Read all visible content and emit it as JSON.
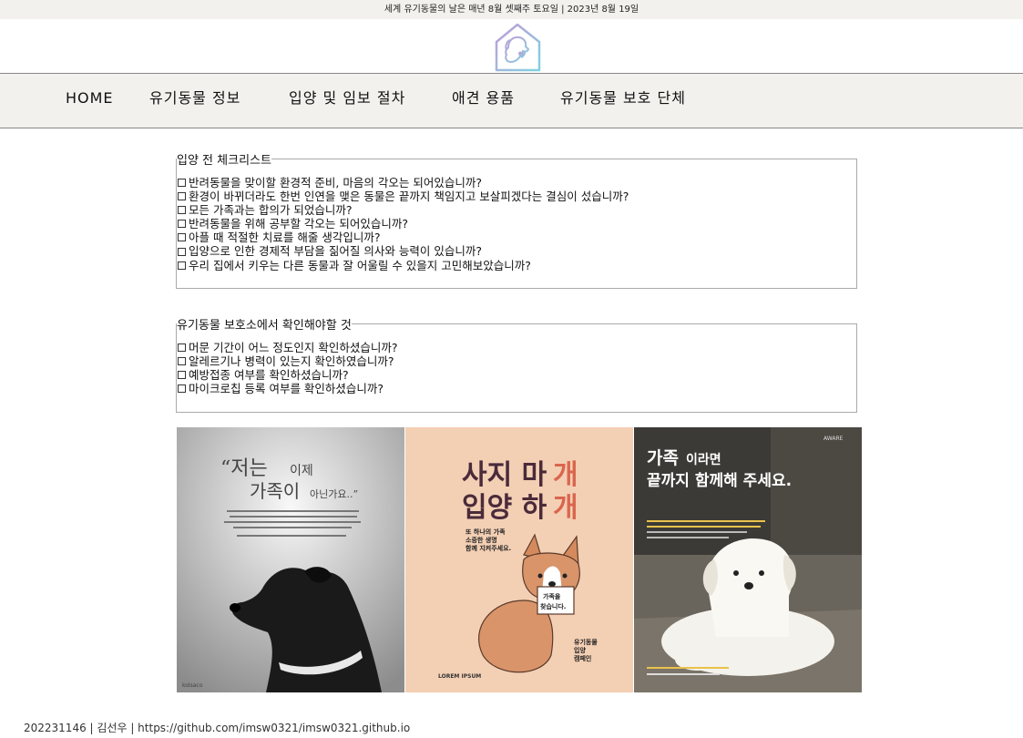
{
  "topbar": {
    "text": "세계 유기동물의 날은 매년 8월 셋째주 토요일 | 2023년 8월 19일"
  },
  "logo": {
    "icon": "house-dog-heart-logo",
    "color_start": "#c49ad8",
    "color_end": "#7fd3e0"
  },
  "nav": {
    "items": [
      {
        "label": "HOME"
      },
      {
        "label": "유기동물 정보"
      },
      {
        "label": "입양 및 임보 절차"
      },
      {
        "label": "애견 용품"
      },
      {
        "label": "유기동물 보호 단체"
      }
    ]
  },
  "checklist1": {
    "legend": "입양 전 체크리스트",
    "items": [
      "반려동물을 맞이할 환경적 준비, 마음의 각오는 되어있습니까?",
      "환경이 바뀌더라도 한번 인연을 맺은 동물은 끝까지 책임지고 보살피겠다는 결심이 섰습니까?",
      "모든 가족과는 합의가 되었습니까?",
      "반려동물을 위해 공부할 각오는 되어있습니까?",
      "아플 때 적절한 치료를 해줄 생각입니까?",
      "입양으로 인한 경제적 부담을 짊어질 의사와 능력이 있습니까?",
      "우리 집에서 키우는 다른 동물과 잘 어울릴 수 있을지 고민해보았습니까?"
    ]
  },
  "checklist2": {
    "legend": "유기동물 보호소에서 확인해야할 것",
    "items": [
      "머문 기간이 어느 정도인지 확인하셨습니까?",
      "알레르기나 병력이 있는지 확인하였습니까?",
      "예방접종 여부를 확인하셨습니까?",
      "마이크로칩 등록 여부를 확인하셨습니까?"
    ]
  },
  "posters": {
    "p1": {
      "headline1": "“저는",
      "headline1b": "이제",
      "headline2": "가족이",
      "headline2b": "아닌가요..”",
      "brand": "kolsaco"
    },
    "p2": {
      "line1a": "사지 마",
      "line1b": "개",
      "line2a": "입양 하",
      "line2b": "개",
      "sub1": "또 하나의 가족",
      "sub2": "소중한 생명",
      "sub3": "함께 지켜주세요.",
      "sign1": "가족을",
      "sign2": "찾습니다.",
      "side1": "유기동물",
      "side2": "입양",
      "side3": "캠페인",
      "lorem": "LOREM IPSUM"
    },
    "p3": {
      "line1a": "가족",
      "line1b": "이라면",
      "line2": "끝까지 함께해 주세요.",
      "brand": "AWARE"
    }
  },
  "footer": {
    "text": "202231146 | 김선우 | https://github.com/imsw0321/imsw0321.github.io"
  }
}
